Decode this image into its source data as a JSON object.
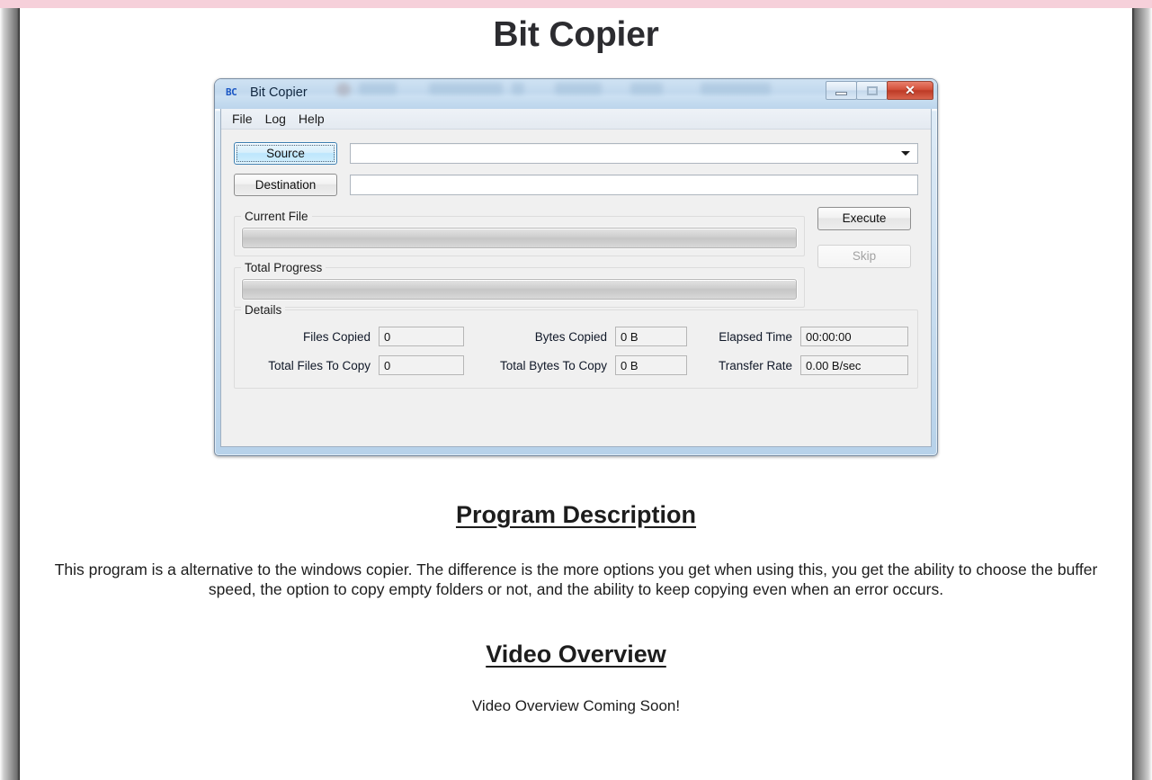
{
  "page": {
    "title": "Bit Copier",
    "accent_pink": "#f6d0da",
    "text_color": "#1d1d1d"
  },
  "app_window": {
    "icon": "bc-logo-icon",
    "icon_text": "BC",
    "title": "Bit Copier",
    "window_buttons": {
      "minimize": "minimize-icon",
      "maximize": "maximize-icon",
      "close_label": "✕"
    },
    "menubar": [
      {
        "label": "File"
      },
      {
        "label": "Log"
      },
      {
        "label": "Help"
      }
    ],
    "paths": {
      "source": {
        "button_label": "Source",
        "value": "",
        "placeholder": "",
        "focused": true,
        "has_dropdown": true
      },
      "destination": {
        "button_label": "Destination",
        "value": "",
        "placeholder": "",
        "focused": false,
        "has_dropdown": false
      }
    },
    "progress": {
      "current_file": {
        "label": "Current File",
        "percent": 0
      },
      "total_progress": {
        "label": "Total Progress",
        "percent": 0
      }
    },
    "actions": {
      "execute": {
        "label": "Execute",
        "enabled": true
      },
      "skip": {
        "label": "Skip",
        "enabled": false
      }
    },
    "details": {
      "title": "Details",
      "rows": [
        {
          "left_label": "Files Copied",
          "left_value": "0",
          "mid_label": "Bytes Copied",
          "mid_value": "0 B",
          "right_label": "Elapsed Time",
          "right_value": "00:00:00"
        },
        {
          "left_label": "Total Files To Copy",
          "left_value": "0",
          "mid_label": "Total Bytes To Copy",
          "mid_value": "0 B",
          "right_label": "Transfer Rate",
          "right_value": "0.00 B/sec"
        }
      ]
    }
  },
  "sections": {
    "description": {
      "heading": "Program Description",
      "body": "This program is a alternative to the windows copier. The difference is the more options you get when using this, you get the ability to choose the buffer speed, the option to copy empty folders or not, and the ability to keep copying even when an error occurs."
    },
    "video": {
      "heading": "Video Overview",
      "note": "Video Overview Coming Soon!"
    }
  }
}
